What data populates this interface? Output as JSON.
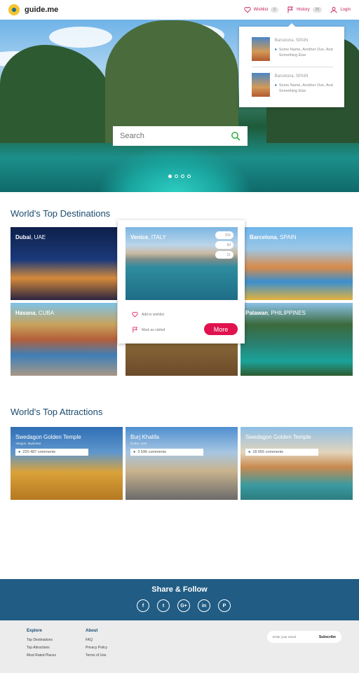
{
  "header": {
    "logo_text": "guide.me",
    "wishlist_label": "Wishlist",
    "wishlist_count": "0",
    "history_label": "History",
    "history_count": "20",
    "login_label": "Login"
  },
  "hero": {
    "search_placeholder": "Search",
    "slides": 4,
    "active_slide": 0
  },
  "history_dropdown": {
    "items": [
      {
        "title": "Barcelona, SPAIN",
        "address": "Some Name, Another Ove, And Something Else"
      },
      {
        "title": "Barcelona, SPAIN",
        "address": "Some Name, Another Ove, And Something Else"
      }
    ]
  },
  "destinations": {
    "title": "World's Top Destinations",
    "items": [
      {
        "city": "Dubai",
        "country": ", UAE"
      },
      {
        "city": "Venice",
        "country": ", ITALY"
      },
      {
        "city": "Barcelona",
        "country": ", SPAIN"
      },
      {
        "city": "Havana",
        "country": ", CUBA"
      },
      {
        "city": "",
        "country": ""
      },
      {
        "city": "Palawan",
        "country": ", PHILIPPINES"
      }
    ],
    "card": {
      "stat_views": "255",
      "stat_likes": "89",
      "stat_visited": "21",
      "wishlist_action": "Add to wishlist",
      "visited_action": "Mark as visited",
      "more_label": "More"
    }
  },
  "attractions": {
    "title": "World's Top Attractions",
    "items": [
      {
        "name": "Swedagon Golden Temple",
        "location": "Yangon, Myanmar",
        "comments": "220 487 comments"
      },
      {
        "name": "Burj Khalifa",
        "location": "Dubai, UAE",
        "comments": "3 596 comments"
      },
      {
        "name": "Swedagon Golden Temple",
        "location": "",
        "comments": "18 655 comments"
      }
    ]
  },
  "share": {
    "title": "Share & Follow",
    "networks": [
      "f",
      "t",
      "G+",
      "in",
      "P"
    ]
  },
  "footer": {
    "explore_title": "Explore",
    "explore_links": [
      "Top Destinations",
      "Top Attractions",
      "Most Rated Places"
    ],
    "about_title": "About",
    "about_links": [
      "FAQ",
      "Privacy Policy",
      "Terms of Use"
    ],
    "email_placeholder": "Enter your email",
    "subscribe_label": "Subscribe"
  }
}
